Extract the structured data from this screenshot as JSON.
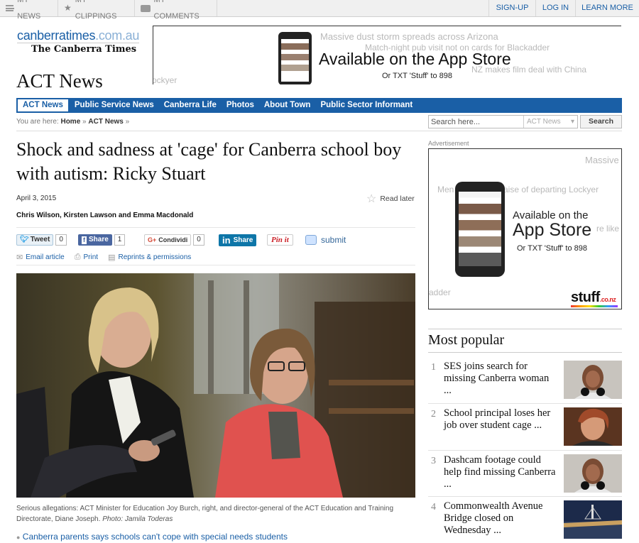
{
  "topbar": {
    "my_news": "MY NEWS",
    "my_clippings": "MY CLIPPINGS",
    "my_comments": "MY COMMENTS",
    "signup": "SIGN-UP",
    "login": "LOG IN",
    "learn_more": "LEARN MORE"
  },
  "masthead": {
    "site_name": "canberratimes",
    "site_domain": ".com.au",
    "paper_name": "The Canberra Times",
    "section_title": "ACT News"
  },
  "top_ad": {
    "ghost_line_1": "Massive dust storm spreads across Arizona",
    "ghost_line_2": "Match-night pub visit not on cards for Blackadder",
    "ghost_line_3": "NZ makes film deal with China",
    "ghost_line_4": "ockyer",
    "headline": "Available on the App Store",
    "sub": "Or TXT 'Stuff' to 898"
  },
  "nav": {
    "items": [
      {
        "label": "ACT News"
      },
      {
        "label": "Public Service News"
      },
      {
        "label": "Canberra Life"
      },
      {
        "label": "Photos"
      },
      {
        "label": "About Town"
      },
      {
        "label": "Public Sector Informant"
      }
    ]
  },
  "breadcrumb": {
    "prefix": "You are here:",
    "home": "Home",
    "current": "ACT News",
    "sep": "»"
  },
  "search": {
    "placeholder": "Search here...",
    "scope": "ACT News",
    "button": "Search"
  },
  "article": {
    "headline": "Shock and sadness at 'cage' for Canberra school boy with autism: Ricky Stuart",
    "date": "April 3, 2015",
    "read_later": "Read later",
    "byline": "Chris Wilson, Kirsten Lawson and Emma Macdonald",
    "share": {
      "tweet": "Tweet",
      "tweet_count": "0",
      "fb_share": "Share",
      "fb_count": "1",
      "gplus": "Condividi",
      "gplus_count": "0",
      "linkedin": "Share",
      "pinterest": "Pin it",
      "reddit": "submit"
    },
    "tools": {
      "email": "Email article",
      "print": "Print",
      "reprints": "Reprints & permissions"
    },
    "caption": "Serious allegations: ACT Minister for Education Joy Burch, right, and director-general of the ACT Education and Training Directorate, Diane Joseph.",
    "credit": "Photo: Jamila Toderas",
    "related_link": "Canberra parents says schools can't cope with special needs students"
  },
  "sidebar": {
    "ad_label": "Advertisement",
    "ad": {
      "ghost_1": "Massive",
      "ghost_2": "Men",
      "ghost_3": "aise of departing Lockyer",
      "ghost_4": "re like",
      "ghost_5": "adder",
      "headline_1": "Available on the",
      "headline_2": "App Store",
      "sub": "Or TXT 'Stuff' to 898",
      "brand": "stuff",
      "brand_suffix": ".co.nz"
    },
    "most_popular_title": "Most popular",
    "most_popular": [
      {
        "num": "1",
        "title": "SES joins search for missing Canberra woman ..."
      },
      {
        "num": "2",
        "title": "School principal loses her job over student cage ..."
      },
      {
        "num": "3",
        "title": "Dashcam footage could help find missing Canberra ..."
      },
      {
        "num": "4",
        "title": "Commonwealth Avenue Bridge closed on Wednesday ..."
      }
    ]
  },
  "colors": {
    "brand_blue": "#1a5fa6",
    "nav_bg": "#1a5fa6"
  }
}
